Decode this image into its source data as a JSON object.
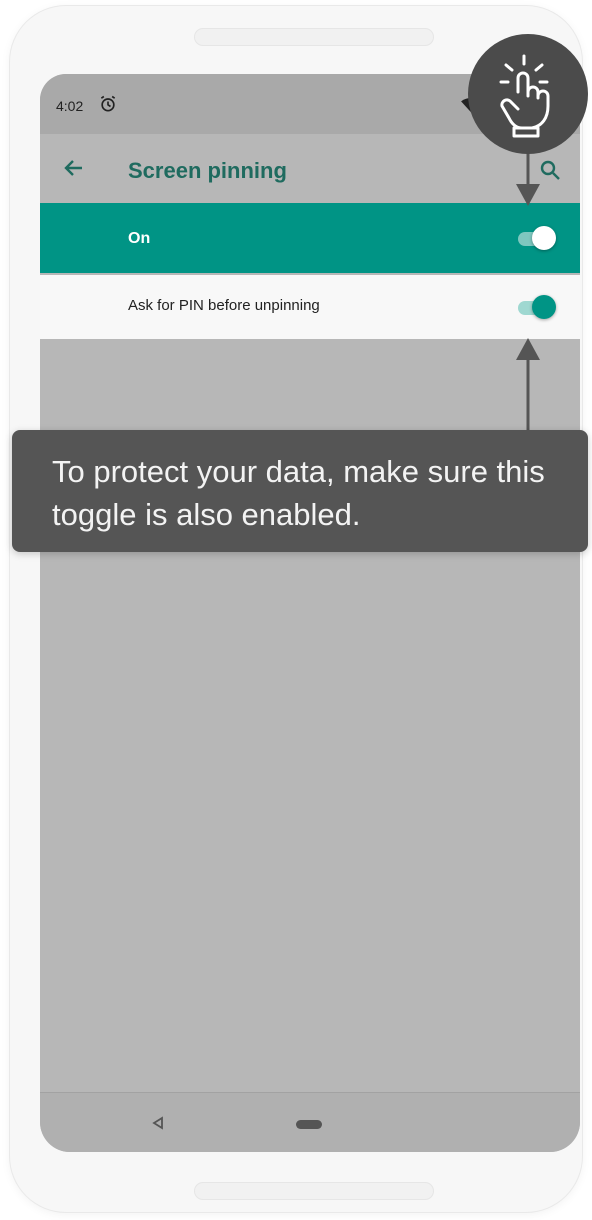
{
  "status_bar": {
    "time": "4:02",
    "alarm_icon": "alarm-clock-icon",
    "wifi_icon": "wifi-icon"
  },
  "app_bar": {
    "title": "Screen pinning",
    "back_icon": "arrow-back-icon",
    "search_icon": "search-icon"
  },
  "settings": [
    {
      "label": "On",
      "enabled": true
    },
    {
      "label": "Ask for PIN before unpinning",
      "enabled": true
    }
  ],
  "tooltip": {
    "text": "To protect your data, make sure this toggle is also enabled."
  },
  "nav_bar": {
    "back_icon": "nav-back-triangle-icon",
    "home_icon": "nav-home-pill-icon"
  },
  "tap_indicator": {
    "icon": "tap-hand-icon"
  },
  "colors": {
    "accent": "#009485",
    "scrim": "#b7b7b7",
    "tooltip_bg": "#555555",
    "title": "#1f6b5f"
  }
}
